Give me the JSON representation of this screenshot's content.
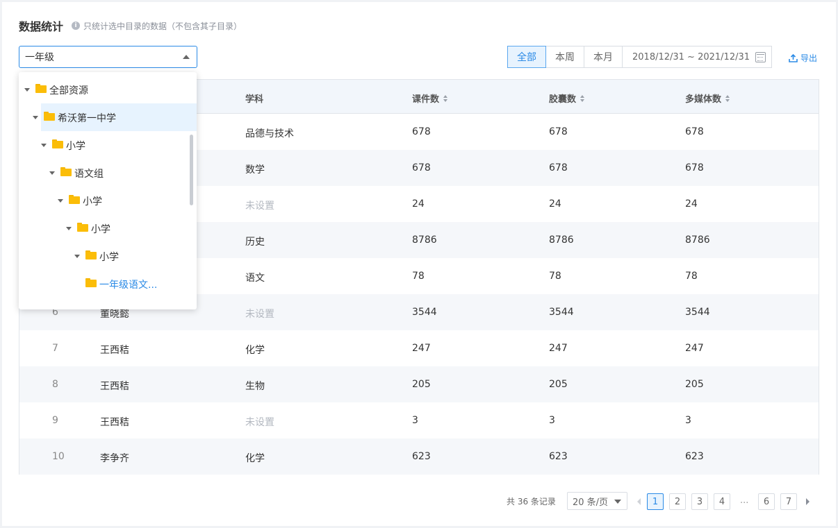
{
  "header": {
    "title": "数据统计",
    "info_icon": "i",
    "subtitle": "只统计选中目录的数据（不包含其子目录）"
  },
  "select": {
    "value": "一年级"
  },
  "range_tabs": [
    {
      "label": "全部",
      "active": true
    },
    {
      "label": "本周",
      "active": false
    },
    {
      "label": "本月",
      "active": false
    }
  ],
  "date_range": "2018/12/31 ~ 2021/12/31",
  "export_label": "导出",
  "table": {
    "columns": [
      "学科",
      "课件数",
      "胶囊数",
      "多媒体数"
    ],
    "rows": [
      {
        "idx": "",
        "name": "",
        "subject": "品德与技术",
        "courseware": "678",
        "capsule": "678",
        "media": "678"
      },
      {
        "idx": "",
        "name": "",
        "subject": "数学",
        "courseware": "678",
        "capsule": "678",
        "media": "678"
      },
      {
        "idx": "",
        "name": "",
        "subject": "未设置",
        "courseware": "24",
        "capsule": "24",
        "media": "24"
      },
      {
        "idx": "",
        "name": "",
        "subject": "历史",
        "courseware": "8786",
        "capsule": "8786",
        "media": "8786"
      },
      {
        "idx": "",
        "name": "",
        "subject": "语文",
        "courseware": "78",
        "capsule": "78",
        "media": "78"
      },
      {
        "idx": "6",
        "name": "董晓懿",
        "subject": "未设置",
        "courseware": "3544",
        "capsule": "3544",
        "media": "3544"
      },
      {
        "idx": "7",
        "name": "王西秸",
        "subject": "化学",
        "courseware": "247",
        "capsule": "247",
        "media": "247"
      },
      {
        "idx": "8",
        "name": "王西秸",
        "subject": "生物",
        "courseware": "205",
        "capsule": "205",
        "media": "205"
      },
      {
        "idx": "9",
        "name": "王西秸",
        "subject": "未设置",
        "courseware": "3",
        "capsule": "3",
        "media": "3"
      },
      {
        "idx": "10",
        "name": "李争齐",
        "subject": "化学",
        "courseware": "623",
        "capsule": "623",
        "media": "623"
      }
    ]
  },
  "pagination": {
    "total": "共 36 条记录",
    "page_size": "20 条/页",
    "pages": [
      "1",
      "2",
      "3",
      "4",
      "6",
      "7"
    ],
    "ellipsis": "...",
    "current": "1"
  },
  "tree": [
    {
      "label": "全部资源",
      "expanded": true
    },
    {
      "label": "希沃第一中学",
      "expanded": true,
      "selected": true
    },
    {
      "label": "小学",
      "expanded": true
    },
    {
      "label": "语文组",
      "expanded": true
    },
    {
      "label": "小学",
      "expanded": true
    },
    {
      "label": "小学",
      "expanded": true
    },
    {
      "label": "小学",
      "expanded": true
    },
    {
      "label": "一年级语文...",
      "expanded": false,
      "highlight": true
    }
  ],
  "colors": {
    "accent": "#2a8ae6",
    "folder": "#fbbd08",
    "header_bg": "#f2f6fb",
    "alt_row": "#f5f7fa"
  }
}
